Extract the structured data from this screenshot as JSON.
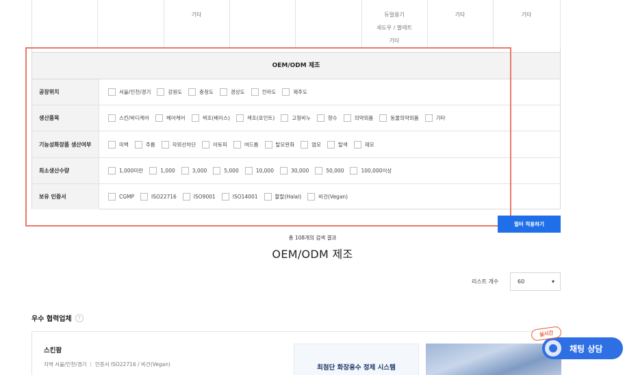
{
  "top_table": {
    "col_2": "기타",
    "col_5": [
      "듀얼용기",
      "새도우 / 팔레트",
      "기타"
    ],
    "col_6": "기타",
    "col_7": "기타"
  },
  "filter": {
    "header": "OEM/ODM 제조",
    "rows": [
      {
        "label": "공장위치",
        "options": [
          "서울/인천/경기",
          "강원도",
          "충청도",
          "경상도",
          "전라도",
          "제주도"
        ]
      },
      {
        "label": "생산품목",
        "options": [
          "스킨/바디케어",
          "헤어케어",
          "색조(베이스)",
          "색조(포인트)",
          "고형비누",
          "향수",
          "의약외품",
          "동물의약외품",
          "기타"
        ]
      },
      {
        "label": "기능성화장품 생산여부",
        "options": [
          "미백",
          "주름",
          "자외선차단",
          "아토피",
          "여드름",
          "탈모완화",
          "염모",
          "탈색",
          "제모"
        ]
      },
      {
        "label": "최소생산수량",
        "options": [
          "1,000미만",
          "1,000",
          "3,000",
          "5,000",
          "10,000",
          "30,000",
          "50,000",
          "100,000이상"
        ]
      },
      {
        "label": "보유 인증서",
        "options": [
          "CGMP",
          "ISO22716",
          "ISO9001",
          "ISO14001",
          "할랄(Halal)",
          "비건(Vegan)"
        ]
      }
    ],
    "apply_label": "필터 적용하기"
  },
  "results": {
    "count_text": "총 108개의 검색 결과",
    "title": "OEM/ODM 제조",
    "list_count_label": "리스트 개수",
    "list_count_value": "60"
  },
  "partners": {
    "section_title": "우수 협력업체",
    "help_icon": "?",
    "card": {
      "name": "스킨팜",
      "info": "지역 서울/인천/경기 ｜ 인증서 ISO22716 / 비건(Vegan)",
      "banner_text": "최첨단 화장용수 정제 시스템"
    }
  },
  "chat": {
    "badge": "실시간",
    "label": "채팅 상담"
  },
  "colors": {
    "highlight": "#e8776a",
    "primary": "#1e6fe8",
    "chat": "#2f6fe4"
  }
}
